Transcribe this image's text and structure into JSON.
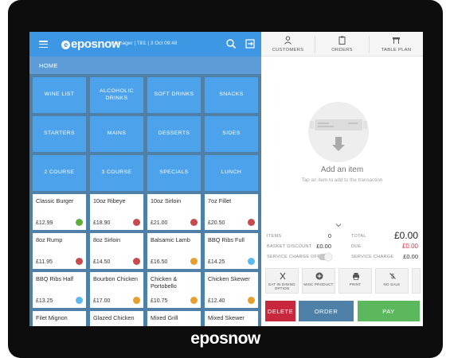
{
  "brand": "eposnow",
  "header": {
    "logo": "eposnow",
    "meta": "Manager  |  Till1  |  3 Oct 09:48",
    "breadcrumb": "HOME"
  },
  "categories": [
    {
      "label": "WINE LIST"
    },
    {
      "label": "ALCOHOLIC DRINKS"
    },
    {
      "label": "SOFT DRINKS"
    },
    {
      "label": "SNACKS"
    },
    {
      "label": "STARTERS"
    },
    {
      "label": "MAINS"
    },
    {
      "label": "DESSERTS"
    },
    {
      "label": "SIDES"
    },
    {
      "label": "2 COURSE"
    },
    {
      "label": "3 COURSE"
    },
    {
      "label": "SPECIALS"
    },
    {
      "label": "LUNCH"
    }
  ],
  "products": [
    {
      "name": "Classic Burger",
      "price": "£12.99",
      "color": "#5fae3b"
    },
    {
      "name": "10oz Ribeye",
      "price": "£18.90",
      "color": "#c84a4a"
    },
    {
      "name": "10oz Sirloin",
      "price": "£21.00",
      "color": "#c84a4a"
    },
    {
      "name": "7oz Fillet",
      "price": "£20.50",
      "color": "#c84a4a"
    },
    {
      "name": "8oz Rump",
      "price": "£11.95",
      "color": "#c84a4a"
    },
    {
      "name": "8oz Sirloin",
      "price": "£14.50",
      "color": "#c84a4a"
    },
    {
      "name": "Balsamic Lamb",
      "price": "£16.50",
      "color": "#e6a02c"
    },
    {
      "name": "BBQ Ribs Full",
      "price": "£14.25",
      "color": "#5bb9ef"
    },
    {
      "name": "BBQ Ribs Half",
      "price": "£13.25",
      "color": "#5bb9ef"
    },
    {
      "name": "Bourbon Chicken",
      "price": "£17.00",
      "color": "#e6a02c"
    },
    {
      "name": "Chicken & Portobello",
      "price": "£10.75",
      "color": "#e6a02c"
    },
    {
      "name": "Chicken Skewer",
      "price": "£12.40",
      "color": "#e6a02c"
    },
    {
      "name": "Filet Mignon",
      "price": "",
      "color": ""
    },
    {
      "name": "Glazed Chicken",
      "price": "",
      "color": ""
    },
    {
      "name": "Mixed Grill",
      "price": "",
      "color": ""
    },
    {
      "name": "Mixed Skewer",
      "price": "",
      "color": ""
    }
  ],
  "tabs": [
    {
      "label": "CUSTOMERS",
      "icon": "person-icon"
    },
    {
      "label": "ORDERS",
      "icon": "clipboard-icon"
    },
    {
      "label": "TABLE PLAN",
      "icon": "table-icon"
    }
  ],
  "transaction": {
    "empty_title": "Add an item",
    "empty_subtitle": "Tap an item to add to the transaction",
    "items_label": "ITEMS",
    "items_value": "0",
    "basket_discount_label": "BASKET DISCOUNT",
    "basket_discount_value": "£0.00",
    "service_charge_toggle_label": "SERVICE CHARGE OFF",
    "total_label": "TOTAL",
    "total_value": "£0.00",
    "due_label": "DUE",
    "due_value": "£0.00",
    "service_charge_label": "SERVICE CHARGE",
    "service_charge_value": "£0.00"
  },
  "actions": [
    {
      "label": "EAT IN DINING OPTION",
      "icon": "cutlery-icon"
    },
    {
      "label": "MISC PRODUCT",
      "icon": "plus-circle-icon"
    },
    {
      "label": "PRINT",
      "icon": "printer-icon"
    },
    {
      "label": "NO SALE",
      "icon": "no-sale-icon"
    }
  ],
  "buttons": {
    "delete": "DELETE",
    "order": "ORDER",
    "pay": "PAY"
  },
  "colors": {
    "topbar": "#3e97e2",
    "category_tile": "#4da2ec",
    "delete": "#c8283d",
    "order": "#4f81a8",
    "pay": "#5bb85c"
  }
}
